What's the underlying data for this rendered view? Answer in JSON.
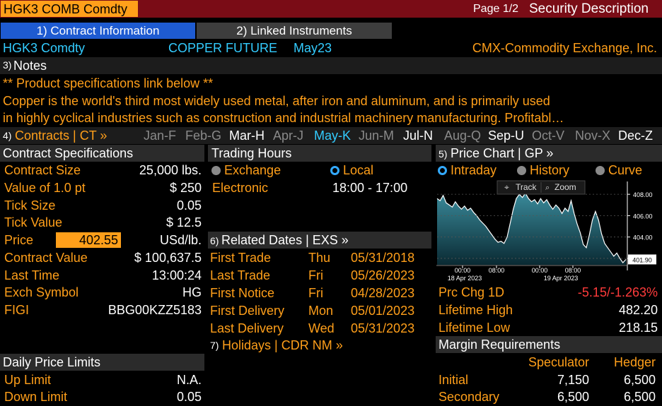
{
  "header": {
    "ticker": "HGK3 COMB Comdty",
    "page": "Page 1/2",
    "title": "Security Description"
  },
  "tabs": [
    {
      "label": "1) Contract Information",
      "active": true
    },
    {
      "label": "2) Linked Instruments",
      "active": false
    }
  ],
  "security": {
    "ticker": "HGK3 Comdty",
    "name": "COPPER FUTURE",
    "month": "May23",
    "exchange": "CMX-Commodity Exchange, Inc."
  },
  "notes": {
    "num": "3)",
    "label": "Notes",
    "link_line": "** Product specifications link below **",
    "text1": "Copper is the world's third most widely used metal, after iron and aluminum, and is primarily used",
    "text2": "in highly cyclical industries such as construction and industrial machinery manufacturing. Profitabl…"
  },
  "contracts": {
    "num": "4)",
    "label": "Contracts | CT »",
    "months": [
      {
        "label": "Jan-F",
        "state": "grey"
      },
      {
        "label": "Feb-G",
        "state": "grey"
      },
      {
        "label": "Mar-H",
        "state": "white"
      },
      {
        "label": "Apr-J",
        "state": "grey"
      },
      {
        "label": "May-K",
        "state": "cyan"
      },
      {
        "label": "Jun-M",
        "state": "grey"
      },
      {
        "label": "Jul-N",
        "state": "white"
      },
      {
        "label": "Aug-Q",
        "state": "grey"
      },
      {
        "label": "Sep-U",
        "state": "white"
      },
      {
        "label": "Oct-V",
        "state": "grey"
      },
      {
        "label": "Nov-X",
        "state": "grey"
      },
      {
        "label": "Dec-Z",
        "state": "white"
      }
    ]
  },
  "specs": {
    "title": "Contract Specifications",
    "contract_size_label": "Contract Size",
    "contract_size": "25,000 lbs.",
    "value_pt_label": "Value of 1.0 pt",
    "value_pt": "$ 250",
    "tick_size_label": "Tick Size",
    "tick_size": "0.05",
    "tick_value_label": "Tick Value",
    "tick_value": "$ 12.5",
    "price_label": "Price",
    "price": "402.55",
    "price_unit": "USd/lb.",
    "contract_value_label": "Contract Value",
    "contract_value": "$ 100,637.5",
    "last_time_label": "Last Time",
    "last_time": "13:00:24",
    "exch_symbol_label": "Exch Symbol",
    "exch_symbol": "HG",
    "figi_label": "FIGI",
    "figi": "BBG00KZZ5183"
  },
  "limits": {
    "title": "Daily Price Limits",
    "up_label": "Up Limit",
    "up": "N.A.",
    "down_label": "Down Limit",
    "down": "0.05"
  },
  "trading_hours": {
    "title": "Trading Hours",
    "exchange_label": "Exchange",
    "local_label": "Local",
    "selected": "Local",
    "session_label": "Electronic",
    "session_hours": "18:00 - 17:00"
  },
  "related_dates": {
    "num": "6)",
    "title": "Related Dates | EXS »",
    "rows": [
      {
        "label": "First Trade",
        "day": "Thu",
        "date": "05/31/2018"
      },
      {
        "label": "Last Trade",
        "day": "Fri",
        "date": "05/26/2023"
      },
      {
        "label": "First Notice",
        "day": "Fri",
        "date": "04/28/2023"
      },
      {
        "label": "First Delivery",
        "day": "Mon",
        "date": "05/01/2023"
      },
      {
        "label": "Last Delivery",
        "day": "Wed",
        "date": "05/31/2023"
      }
    ],
    "holidays_num": "7)",
    "holidays_label": "Holidays | CDR NM »"
  },
  "price_chart": {
    "num": "5)",
    "title": "Price Chart | GP »",
    "modes": [
      "Intraday",
      "History",
      "Curve"
    ],
    "selected_mode": "Intraday",
    "track_label": "Track",
    "zoom_label": "Zoom",
    "last_label": "401.90"
  },
  "chart_data": {
    "type": "area",
    "title": "",
    "xlabel": "",
    "ylabel": "",
    "ylim": [
      401.4,
      409.2
    ],
    "y_ticks": [
      "408.00",
      "406.00",
      "404.00",
      "402.00"
    ],
    "x_tick_times": [
      "00:00",
      "08:00",
      "00:00",
      "08:00"
    ],
    "x_tick_dates": [
      "18 Apr 2023",
      "19 Apr 2023"
    ],
    "series": [
      {
        "values": [
          407.6,
          407.4,
          407.9,
          407.2,
          407.0,
          406.8,
          407.3,
          406.9,
          406.6,
          406.9,
          406.5,
          406.7,
          406.3,
          406.0,
          405.6,
          405.3,
          405.0,
          404.6,
          404.2,
          403.8,
          403.5,
          403.6,
          403.4,
          404.0,
          405.3,
          406.6,
          407.6,
          408.0,
          407.7,
          408.1,
          407.6,
          407.3,
          407.5,
          407.1,
          407.6,
          407.2,
          407.5,
          407.0,
          406.6,
          407.0,
          406.7,
          406.2,
          406.7,
          406.4,
          407.4,
          406.2,
          405.2,
          404.4,
          403.3,
          403.0,
          404.2,
          405.6,
          406.4,
          405.6,
          404.3,
          403.4,
          403.0,
          402.6,
          402.2,
          402.5,
          402.0,
          401.6,
          401.9
        ]
      }
    ]
  },
  "stats": {
    "prc_chg_label": "Prc Chg 1D",
    "prc_chg": "-5.15/-1.263%",
    "lifetime_high_label": "Lifetime High",
    "lifetime_high": "482.20",
    "lifetime_low_label": "Lifetime Low",
    "lifetime_low": "218.15"
  },
  "margin": {
    "title": "Margin Requirements",
    "speculator_label": "Speculator",
    "hedger_label": "Hedger",
    "initial_label": "Initial",
    "initial_spec": "7,150",
    "initial_hedge": "6,500",
    "secondary_label": "Secondary",
    "secondary_spec": "6,500",
    "secondary_hedge": "6,500"
  }
}
